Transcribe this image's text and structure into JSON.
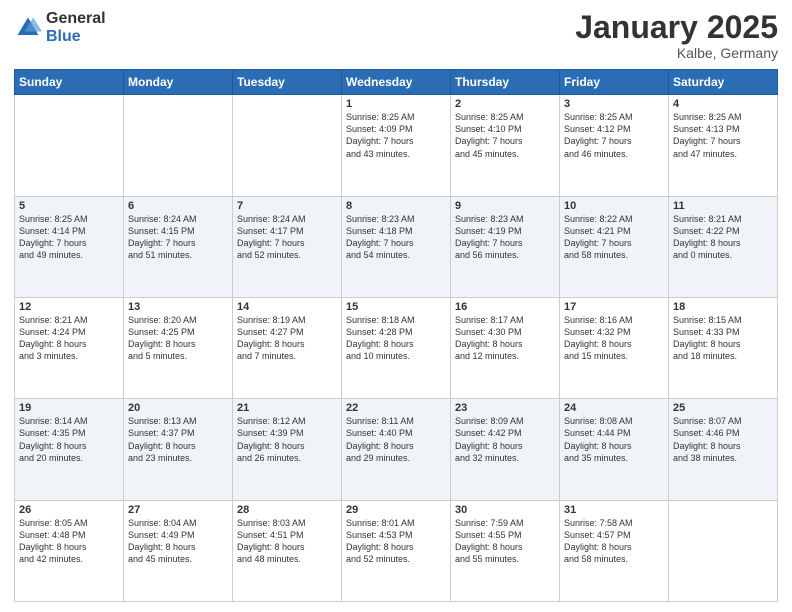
{
  "logo": {
    "general": "General",
    "blue": "Blue"
  },
  "header": {
    "month": "January 2025",
    "location": "Kalbe, Germany"
  },
  "weekdays": [
    "Sunday",
    "Monday",
    "Tuesday",
    "Wednesday",
    "Thursday",
    "Friday",
    "Saturday"
  ],
  "weeks": [
    [
      {
        "day": "",
        "info": ""
      },
      {
        "day": "",
        "info": ""
      },
      {
        "day": "",
        "info": ""
      },
      {
        "day": "1",
        "info": "Sunrise: 8:25 AM\nSunset: 4:09 PM\nDaylight: 7 hours\nand 43 minutes."
      },
      {
        "day": "2",
        "info": "Sunrise: 8:25 AM\nSunset: 4:10 PM\nDaylight: 7 hours\nand 45 minutes."
      },
      {
        "day": "3",
        "info": "Sunrise: 8:25 AM\nSunset: 4:12 PM\nDaylight: 7 hours\nand 46 minutes."
      },
      {
        "day": "4",
        "info": "Sunrise: 8:25 AM\nSunset: 4:13 PM\nDaylight: 7 hours\nand 47 minutes."
      }
    ],
    [
      {
        "day": "5",
        "info": "Sunrise: 8:25 AM\nSunset: 4:14 PM\nDaylight: 7 hours\nand 49 minutes."
      },
      {
        "day": "6",
        "info": "Sunrise: 8:24 AM\nSunset: 4:15 PM\nDaylight: 7 hours\nand 51 minutes."
      },
      {
        "day": "7",
        "info": "Sunrise: 8:24 AM\nSunset: 4:17 PM\nDaylight: 7 hours\nand 52 minutes."
      },
      {
        "day": "8",
        "info": "Sunrise: 8:23 AM\nSunset: 4:18 PM\nDaylight: 7 hours\nand 54 minutes."
      },
      {
        "day": "9",
        "info": "Sunrise: 8:23 AM\nSunset: 4:19 PM\nDaylight: 7 hours\nand 56 minutes."
      },
      {
        "day": "10",
        "info": "Sunrise: 8:22 AM\nSunset: 4:21 PM\nDaylight: 7 hours\nand 58 minutes."
      },
      {
        "day": "11",
        "info": "Sunrise: 8:21 AM\nSunset: 4:22 PM\nDaylight: 8 hours\nand 0 minutes."
      }
    ],
    [
      {
        "day": "12",
        "info": "Sunrise: 8:21 AM\nSunset: 4:24 PM\nDaylight: 8 hours\nand 3 minutes."
      },
      {
        "day": "13",
        "info": "Sunrise: 8:20 AM\nSunset: 4:25 PM\nDaylight: 8 hours\nand 5 minutes."
      },
      {
        "day": "14",
        "info": "Sunrise: 8:19 AM\nSunset: 4:27 PM\nDaylight: 8 hours\nand 7 minutes."
      },
      {
        "day": "15",
        "info": "Sunrise: 8:18 AM\nSunset: 4:28 PM\nDaylight: 8 hours\nand 10 minutes."
      },
      {
        "day": "16",
        "info": "Sunrise: 8:17 AM\nSunset: 4:30 PM\nDaylight: 8 hours\nand 12 minutes."
      },
      {
        "day": "17",
        "info": "Sunrise: 8:16 AM\nSunset: 4:32 PM\nDaylight: 8 hours\nand 15 minutes."
      },
      {
        "day": "18",
        "info": "Sunrise: 8:15 AM\nSunset: 4:33 PM\nDaylight: 8 hours\nand 18 minutes."
      }
    ],
    [
      {
        "day": "19",
        "info": "Sunrise: 8:14 AM\nSunset: 4:35 PM\nDaylight: 8 hours\nand 20 minutes."
      },
      {
        "day": "20",
        "info": "Sunrise: 8:13 AM\nSunset: 4:37 PM\nDaylight: 8 hours\nand 23 minutes."
      },
      {
        "day": "21",
        "info": "Sunrise: 8:12 AM\nSunset: 4:39 PM\nDaylight: 8 hours\nand 26 minutes."
      },
      {
        "day": "22",
        "info": "Sunrise: 8:11 AM\nSunset: 4:40 PM\nDaylight: 8 hours\nand 29 minutes."
      },
      {
        "day": "23",
        "info": "Sunrise: 8:09 AM\nSunset: 4:42 PM\nDaylight: 8 hours\nand 32 minutes."
      },
      {
        "day": "24",
        "info": "Sunrise: 8:08 AM\nSunset: 4:44 PM\nDaylight: 8 hours\nand 35 minutes."
      },
      {
        "day": "25",
        "info": "Sunrise: 8:07 AM\nSunset: 4:46 PM\nDaylight: 8 hours\nand 38 minutes."
      }
    ],
    [
      {
        "day": "26",
        "info": "Sunrise: 8:05 AM\nSunset: 4:48 PM\nDaylight: 8 hours\nand 42 minutes."
      },
      {
        "day": "27",
        "info": "Sunrise: 8:04 AM\nSunset: 4:49 PM\nDaylight: 8 hours\nand 45 minutes."
      },
      {
        "day": "28",
        "info": "Sunrise: 8:03 AM\nSunset: 4:51 PM\nDaylight: 8 hours\nand 48 minutes."
      },
      {
        "day": "29",
        "info": "Sunrise: 8:01 AM\nSunset: 4:53 PM\nDaylight: 8 hours\nand 52 minutes."
      },
      {
        "day": "30",
        "info": "Sunrise: 7:59 AM\nSunset: 4:55 PM\nDaylight: 8 hours\nand 55 minutes."
      },
      {
        "day": "31",
        "info": "Sunrise: 7:58 AM\nSunset: 4:57 PM\nDaylight: 8 hours\nand 58 minutes."
      },
      {
        "day": "",
        "info": ""
      }
    ]
  ]
}
